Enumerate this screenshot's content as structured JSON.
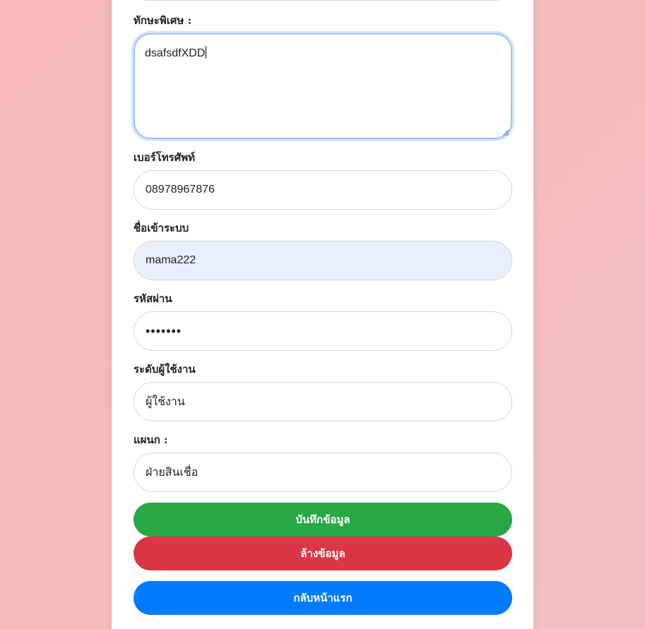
{
  "form": {
    "skills": {
      "label": "ทักษะพิเศษ :",
      "value": "dsafsdfXDD"
    },
    "phone": {
      "label": "เบอร์โทรศัพท์",
      "value": "08978967876"
    },
    "username": {
      "label": "ชื่อเข้าระบบ",
      "value": "mama222"
    },
    "password": {
      "label": "รหัสผ่าน",
      "value": "•••••••"
    },
    "user_level": {
      "label": "ระดับผู้ใช้งาน",
      "value": "ผู้ใช้งาน"
    },
    "department": {
      "label": "แผนก :",
      "value": "ฝ่ายสินเชื่อ"
    }
  },
  "buttons": {
    "save_label": "บันทึกข้อมูล",
    "clear_label": "ล้างข้อมูล",
    "home_label": "กลับหน้าแรก"
  },
  "colors": {
    "save": "#28a745",
    "clear": "#dc3545",
    "home": "#007bff",
    "autofill_bg": "#e8f0fe",
    "page_bg": "#f5bcbc"
  }
}
